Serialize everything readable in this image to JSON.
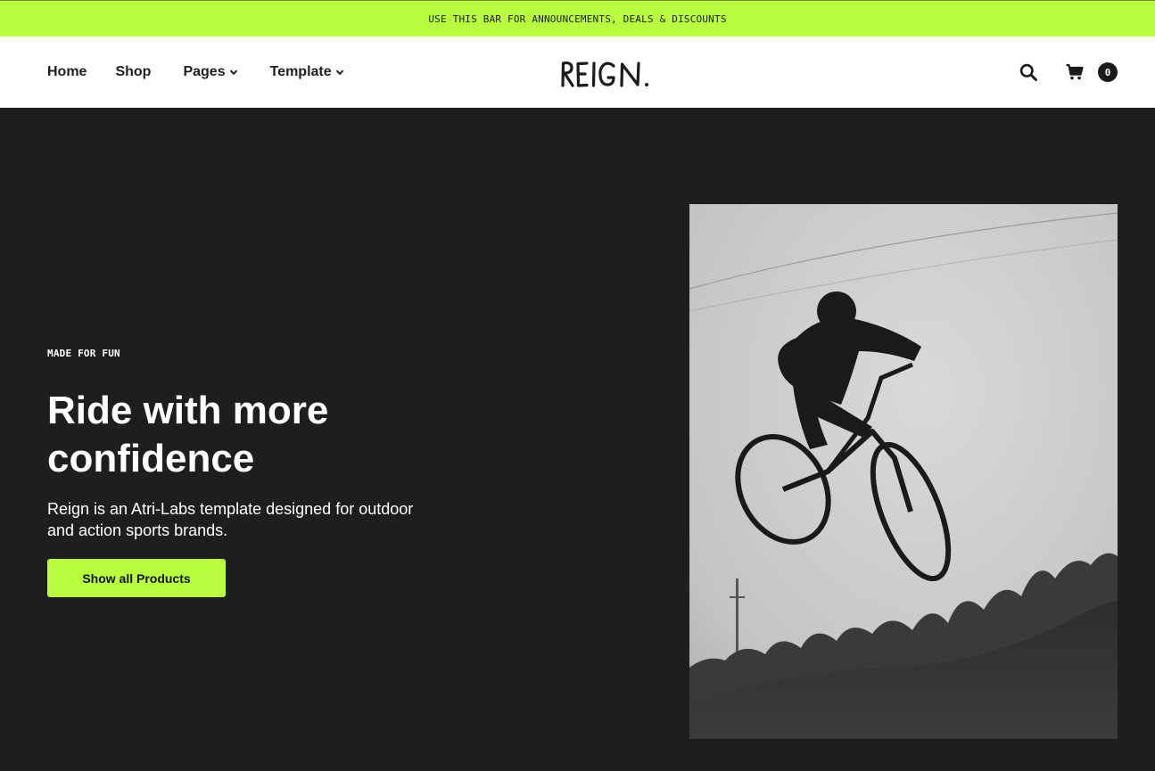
{
  "announcement": {
    "text": "USE THIS BAR FOR ANNOUNCEMENTS, DEALS & DISCOUNTS"
  },
  "nav": {
    "items": [
      {
        "label": "Home"
      },
      {
        "label": "Shop"
      },
      {
        "label": "Pages",
        "has_dropdown": true
      },
      {
        "label": "Template",
        "has_dropdown": true
      }
    ]
  },
  "brand": {
    "logo_text": "REIGN"
  },
  "header": {
    "search_icon": "search-icon",
    "cart_icon": "cart-icon",
    "cart_count": "0"
  },
  "hero": {
    "eyebrow": "MADE FOR FUN",
    "title": "Ride with more confidence",
    "subtitle": "Reign is an Atri-Labs template designed for outdoor and action sports brands.",
    "cta_label": "Show all Products"
  },
  "colors": {
    "accent": "#b9ff3f",
    "dark_bg": "#1e1e1e",
    "text_dark": "#1b1b1b"
  }
}
